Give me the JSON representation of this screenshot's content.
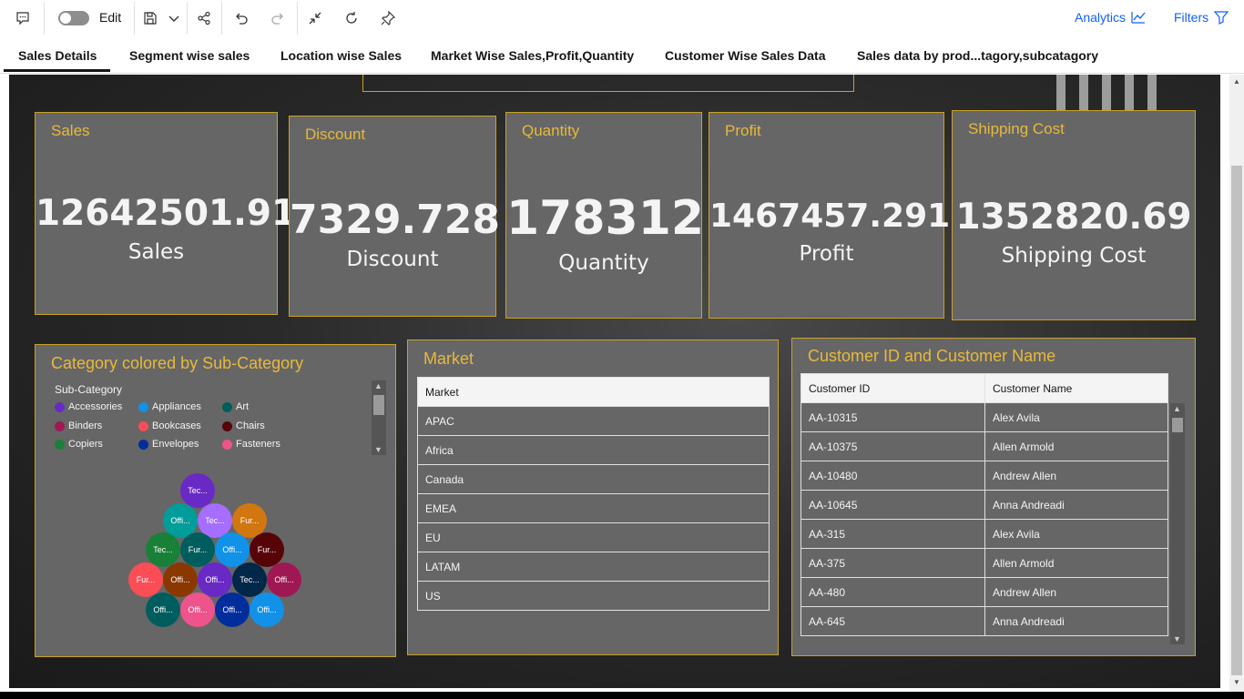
{
  "toolbar": {
    "edit_label": "Edit",
    "analytics_label": "Analytics",
    "filters_label": "Filters",
    "accent_color": "#0f62fe"
  },
  "tabs": [
    {
      "label": "Sales Details",
      "active": true
    },
    {
      "label": "Segment wise sales"
    },
    {
      "label": "Location wise Sales"
    },
    {
      "label": "Market Wise Sales,Profit,Quantity"
    },
    {
      "label": "Customer Wise Sales Data"
    },
    {
      "label": "Sales data by prod...tagory,subcatagory"
    }
  ],
  "kpis": [
    {
      "title": "Sales",
      "value": "12642501.91",
      "label": "Sales"
    },
    {
      "title": "Discount",
      "value": "7329.728",
      "label": "Discount"
    },
    {
      "title": "Quantity",
      "value": "178312",
      "label": "Quantity"
    },
    {
      "title": "Profit",
      "value": "1467457.291",
      "label": "Profit"
    },
    {
      "title": "Shipping Cost",
      "value": "1352820.69",
      "label": "Shipping Cost"
    }
  ],
  "category_chart": {
    "title": "Category colored by Sub-Category",
    "legend_title": "Sub-Category",
    "legend": [
      {
        "name": "Accessories",
        "color": "#6929c4"
      },
      {
        "name": "Appliances",
        "color": "#1192e8"
      },
      {
        "name": "Art",
        "color": "#005d5d"
      },
      {
        "name": "Binders",
        "color": "#9f1853"
      },
      {
        "name": "Bookcases",
        "color": "#fa4d56"
      },
      {
        "name": "Chairs",
        "color": "#570408"
      },
      {
        "name": "Copiers",
        "color": "#198038"
      },
      {
        "name": "Envelopes",
        "color": "#002d9c"
      },
      {
        "name": "Fasteners",
        "color": "#ee538b"
      }
    ],
    "bubbles": [
      {
        "label": "Tec...",
        "color": "#6929c4"
      },
      {
        "label": "Offi...",
        "color": "#009d9a"
      },
      {
        "label": "Tec...",
        "color": "#a56eff"
      },
      {
        "label": "Fur...",
        "color": "#d2770f"
      },
      {
        "label": "Tec...",
        "color": "#198038"
      },
      {
        "label": "Fur...",
        "color": "#005d5d"
      },
      {
        "label": "Offi...",
        "color": "#1192e8"
      },
      {
        "label": "Fur...",
        "color": "#570408"
      },
      {
        "label": "Fur...",
        "color": "#fa4d56"
      },
      {
        "label": "Offi...",
        "color": "#8a3800"
      },
      {
        "label": "Offi...",
        "color": "#6929c4"
      },
      {
        "label": "Tec...",
        "color": "#012749"
      },
      {
        "label": "Offi...",
        "color": "#9f1853"
      },
      {
        "label": "Offi...",
        "color": "#005d5d"
      },
      {
        "label": "Offi...",
        "color": "#ee538b"
      },
      {
        "label": "Offi...",
        "color": "#002d9c"
      },
      {
        "label": "Offi...",
        "color": "#1192e8"
      }
    ]
  },
  "market_panel": {
    "title": "Market",
    "header": "Market",
    "rows": [
      "APAC",
      "Africa",
      "Canada",
      "EMEA",
      "EU",
      "LATAM",
      "US"
    ]
  },
  "customer_panel": {
    "title": "Customer ID and Customer Name",
    "headers": [
      "Customer ID",
      "Customer Name"
    ],
    "rows": [
      [
        "AA-10315",
        "Alex Avila"
      ],
      [
        "AA-10375",
        "Allen Armold"
      ],
      [
        "AA-10480",
        "Andrew Allen"
      ],
      [
        "AA-10645",
        "Anna Andreadi"
      ],
      [
        "AA-315",
        "Alex Avila"
      ],
      [
        "AA-375",
        "Allen Armold"
      ],
      [
        "AA-480",
        "Andrew Allen"
      ],
      [
        "AA-645",
        "Anna Andreadi"
      ]
    ]
  }
}
